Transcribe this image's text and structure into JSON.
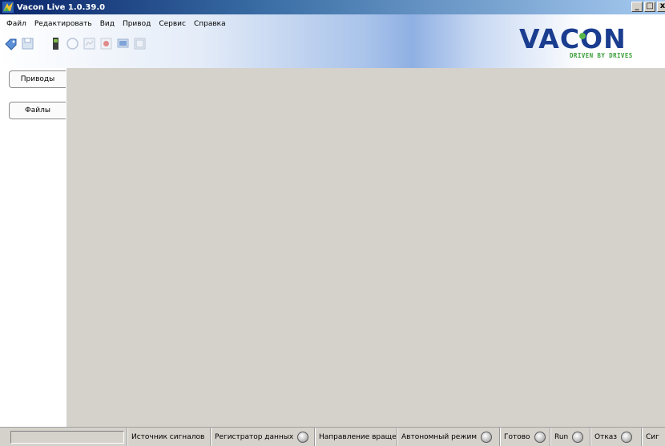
{
  "window": {
    "title": "Vacon Live 1.0.39.0",
    "controls": {
      "minimize": "_",
      "maximize": "□",
      "close": "x"
    }
  },
  "menu": {
    "items": [
      "Файл",
      "Редактировать",
      "Вид",
      "Привод",
      "Сервис",
      "Справка"
    ]
  },
  "toolbar": {
    "buttons": [
      "connect-icon",
      "save-icon",
      "drive-icon",
      "record-icon",
      "chart-icon",
      "stop-icon",
      "monitor-icon",
      "panel-icon"
    ]
  },
  "logo": {
    "brand": "VACON",
    "tagline": "DRIVEN BY DRIVES",
    "colors": {
      "brand": "#1a3d8f",
      "tagline": "#3aa03a"
    }
  },
  "nav": {
    "tabs": [
      "Приводы",
      "Файлы"
    ]
  },
  "status": {
    "cells": [
      {
        "label": "Источник сигналов",
        "led": false
      },
      {
        "label": "Регистратор данных",
        "led": true
      },
      {
        "label": "Направление враще",
        "led": false
      },
      {
        "label": "Автономный режим",
        "led": true
      },
      {
        "label": "Готово",
        "led": true
      },
      {
        "label": "Run",
        "led": true
      },
      {
        "label": "Отказ",
        "led": true
      },
      {
        "label": "Сиг",
        "led": false
      }
    ]
  },
  "colors": {
    "workspace": "#d5d1cb",
    "titlebar_start": "#0a246a"
  }
}
